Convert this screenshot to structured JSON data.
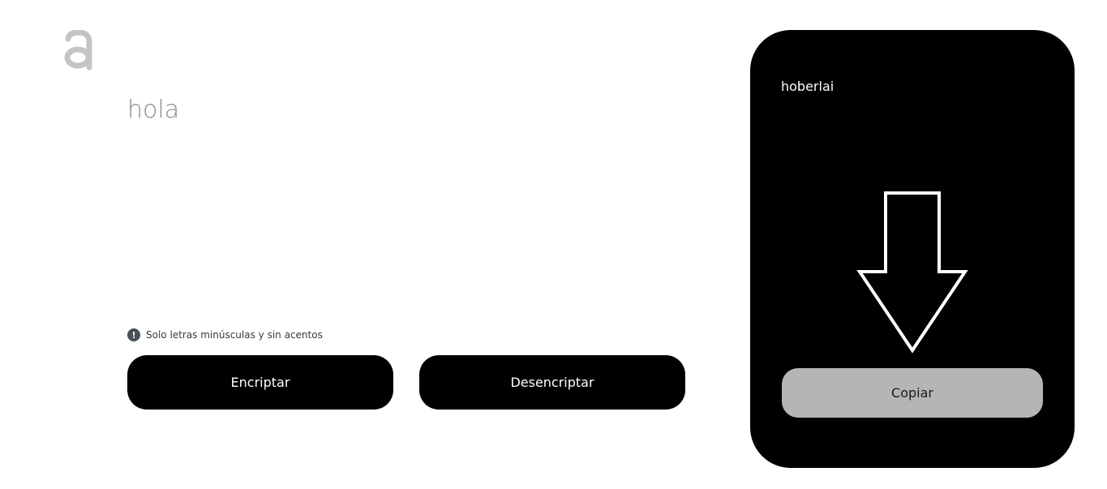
{
  "logo": {
    "icon": "a-logo-icon",
    "color": "#c4c4c8"
  },
  "input": {
    "value": "hola"
  },
  "hint": {
    "icon": "exclamation-circle-icon",
    "text": "Solo letras minúsculas y sin acentos"
  },
  "buttons": {
    "encrypt_label": "Encriptar",
    "decrypt_label": "Desencriptar"
  },
  "output": {
    "text": "hoberlai",
    "arrow_icon": "arrow-down-icon",
    "copy_label": "Copiar"
  },
  "colors": {
    "button_bg": "#000000",
    "panel_bg": "#000000",
    "copy_bg": "#b5b5b5",
    "input_text": "#8a8a8f"
  }
}
